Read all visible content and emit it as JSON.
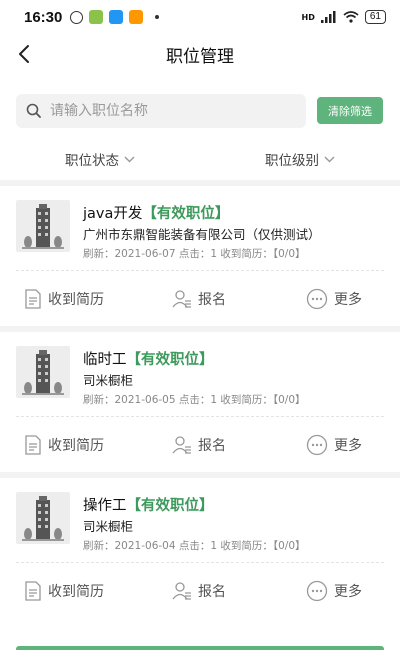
{
  "status_bar": {
    "time": "16:30",
    "battery": "61",
    "network": "HD"
  },
  "header": {
    "title": "职位管理"
  },
  "search": {
    "placeholder": "请输入职位名称",
    "clear_label": "清除筛选"
  },
  "filters": [
    {
      "label": "职位状态"
    },
    {
      "label": "职位级别"
    }
  ],
  "jobs": [
    {
      "title": "java开发",
      "status": "【有效职位】",
      "company": "广州市东鼎智能装备有限公司（仅供测试）",
      "meta": "刷新：2021-06-07 点击：1 收到简历：【0/0】"
    },
    {
      "title": "临时工",
      "status": "【有效职位】",
      "company": "司米橱柜",
      "meta": "刷新：2021-06-05 点击：1 收到简历：【0/0】"
    },
    {
      "title": "操作工",
      "status": "【有效职位】",
      "company": "司米橱柜",
      "meta": "刷新：2021-06-04 点击：1 收到简历：【0/0】"
    }
  ],
  "actions": {
    "resume_label": "收到简历",
    "signup_label": "报名",
    "more_label": "更多"
  },
  "colors": {
    "accent": "#5fb37c",
    "status_green": "#3d9a5c"
  },
  "icons": [
    "back-arrow-icon",
    "search-icon",
    "chevron-down-icon",
    "building-icon",
    "document-icon",
    "user-icon",
    "more-dots-icon"
  ]
}
